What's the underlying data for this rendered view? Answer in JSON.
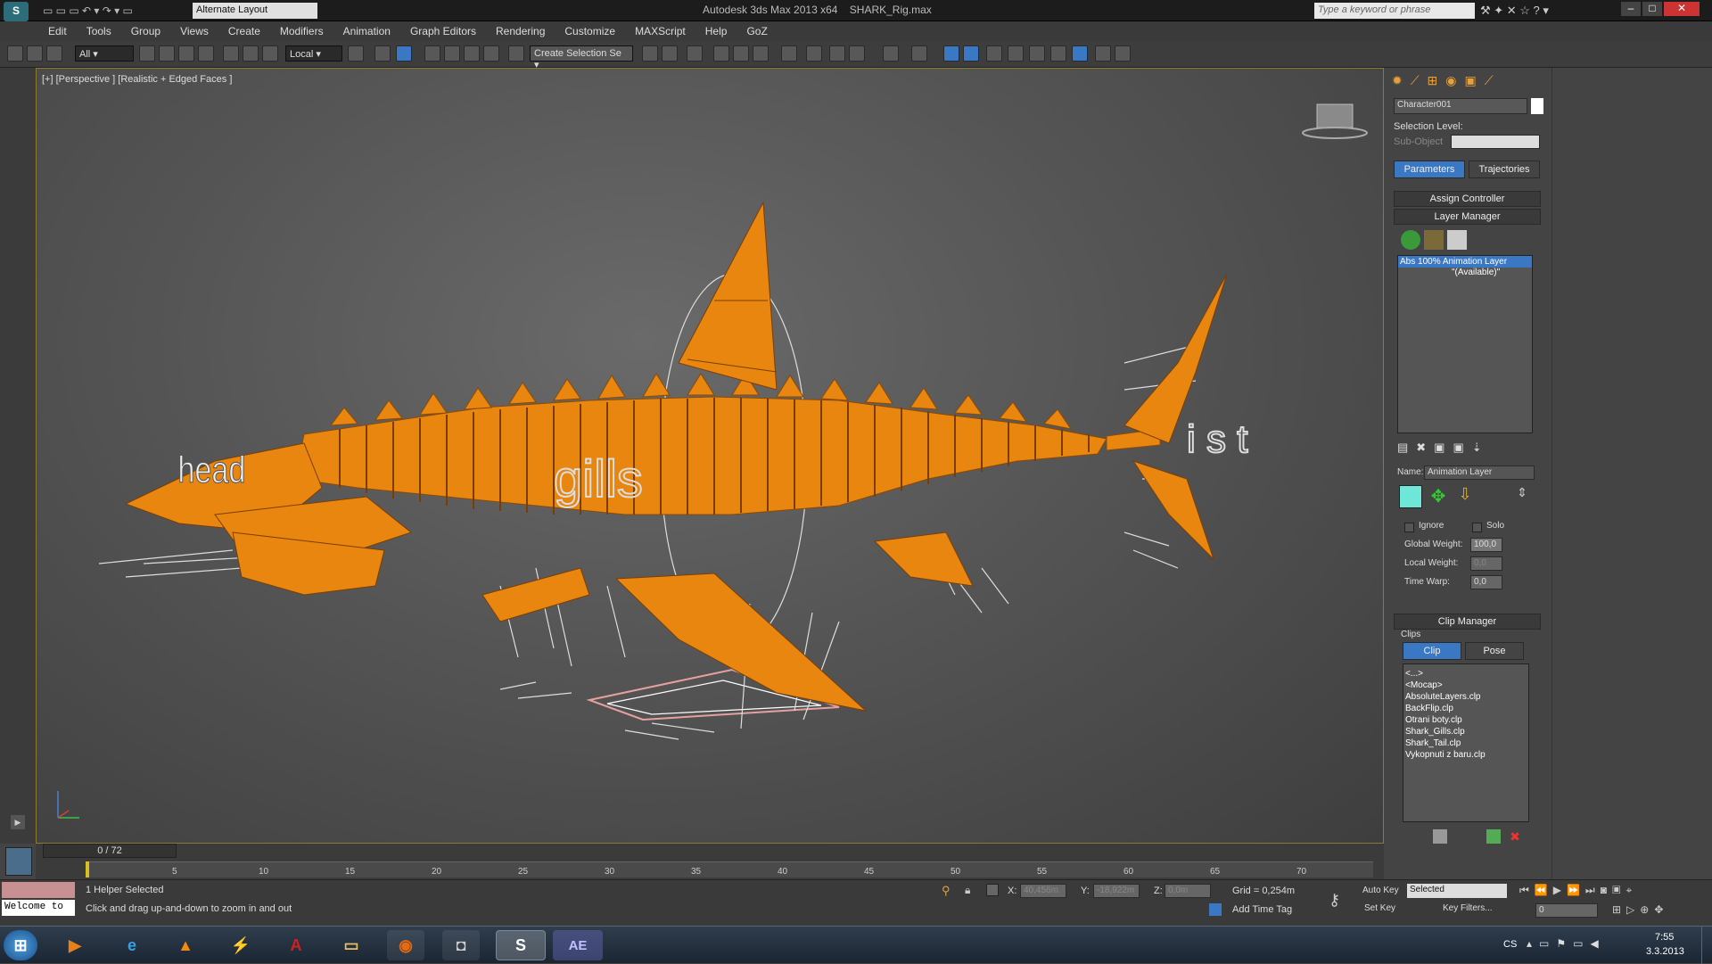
{
  "window": {
    "title": "Autodesk 3ds Max 2013 x64",
    "file": "SHARK_Rig.max",
    "workspace": "Alternate Layout",
    "search_placeholder": "Type a keyword or phrase"
  },
  "menu": [
    "Edit",
    "Tools",
    "Group",
    "Views",
    "Create",
    "Modifiers",
    "Animation",
    "Graph Editors",
    "Rendering",
    "Customize",
    "MAXScript",
    "Help",
    "GoZ"
  ],
  "toolbar": {
    "filter": "All",
    "coord": "Local",
    "selset": "Create Selection Se"
  },
  "viewport": {
    "label": "[+] [Perspective ] [Realistic + Edged Faces ]",
    "text_head": "head",
    "text_gills": "gills",
    "text_tail": "i s t"
  },
  "panel": {
    "object_name": "Character001",
    "selection_level": "Selection Level:",
    "sub_object": "Sub-Object",
    "tab_parameters": "Parameters",
    "tab_trajectories": "Trajectories",
    "assign_controller": "Assign Controller",
    "layer_manager": "Layer Manager",
    "layer_item": "Abs 100% Animation Layer",
    "layer_available": "\"(Available)\"",
    "name_label": "Name:",
    "name_value": "Animation Layer",
    "ignore": "Ignore",
    "solo": "Solo",
    "global_weight_label": "Global Weight:",
    "global_weight": "100,0",
    "local_weight_label": "Local Weight:",
    "local_weight": "0,0",
    "time_warp_label": "Time Warp:",
    "time_warp": "0,0",
    "clip_manager": "Clip Manager",
    "clips_label": "Clips",
    "tab_clip": "Clip",
    "tab_pose": "Pose",
    "clips": [
      "<...>",
      "<Mocap>",
      "AbsoluteLayers.clp",
      "BackFlip.clp",
      "Otrani boty.clp",
      "Shark_Gills.clp",
      "Shark_Tail.clp",
      "Vykopnuti z baru.clp"
    ]
  },
  "timeline": {
    "frame": "0 / 72",
    "ticks": [
      "5",
      "10",
      "15",
      "20",
      "25",
      "30",
      "35",
      "40",
      "45",
      "50",
      "55",
      "60",
      "65",
      "70"
    ]
  },
  "status": {
    "maxscript": "Welcome to",
    "selected": "1 Helper Selected",
    "prompt": "Click and drag up-and-down to zoom in and out",
    "x_label": "X:",
    "x": "40,456m",
    "y_label": "Y:",
    "y": "-18,922m",
    "z_label": "Z:",
    "z": "0,0m",
    "grid": "Grid = 0,254m",
    "add_time_tag": "Add Time Tag",
    "auto_key": "Auto Key",
    "set_key": "Set Key",
    "key_mode": "Selected",
    "key_filters": "Key Filters...",
    "current_frame": "0"
  },
  "taskbar": {
    "lang": "CS",
    "time": "7:55",
    "date": "3.3.2013",
    "ae": "AE"
  },
  "colors": {
    "shark": "#e8860f",
    "accent": "#3b78c4"
  }
}
